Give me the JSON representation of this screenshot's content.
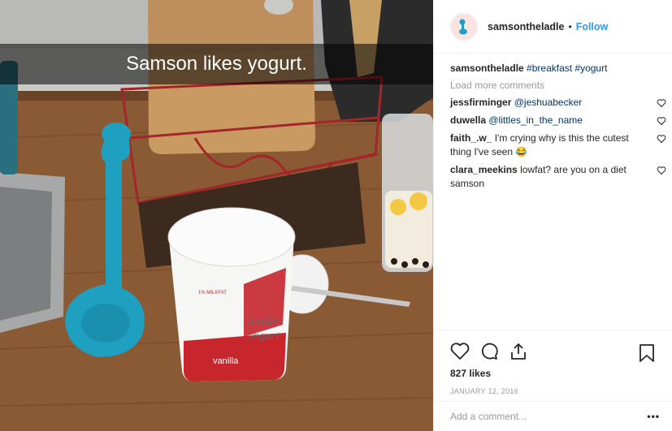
{
  "photo": {
    "caption": "Samson likes yogurt."
  },
  "header": {
    "username": "samsontheladle",
    "separator": "•",
    "follow_label": "Follow",
    "avatar_icon": "ladle-avatar-icon"
  },
  "post_caption": {
    "username": "samsontheladle",
    "text": "#breakfast #yogurt"
  },
  "load_more_label": "Load more comments",
  "comments": [
    {
      "username": "jessfirminger",
      "text": "@jeshuabecker"
    },
    {
      "username": "duwella",
      "text": "@littles_in_the_name"
    },
    {
      "username": "faith_.w_",
      "text": "I'm crying why is this the cutest thing I've seen 😂"
    },
    {
      "username": "clara_meekins",
      "text": "lowfat? are you on a diet samson"
    }
  ],
  "likes": "827 likes",
  "date": "JANUARY 12, 2016",
  "add_comment": {
    "placeholder": "Add a comment..."
  },
  "more_label": "•••",
  "colors": {
    "link": "#3897f0",
    "hashtag": "#003569",
    "muted": "#999999"
  }
}
